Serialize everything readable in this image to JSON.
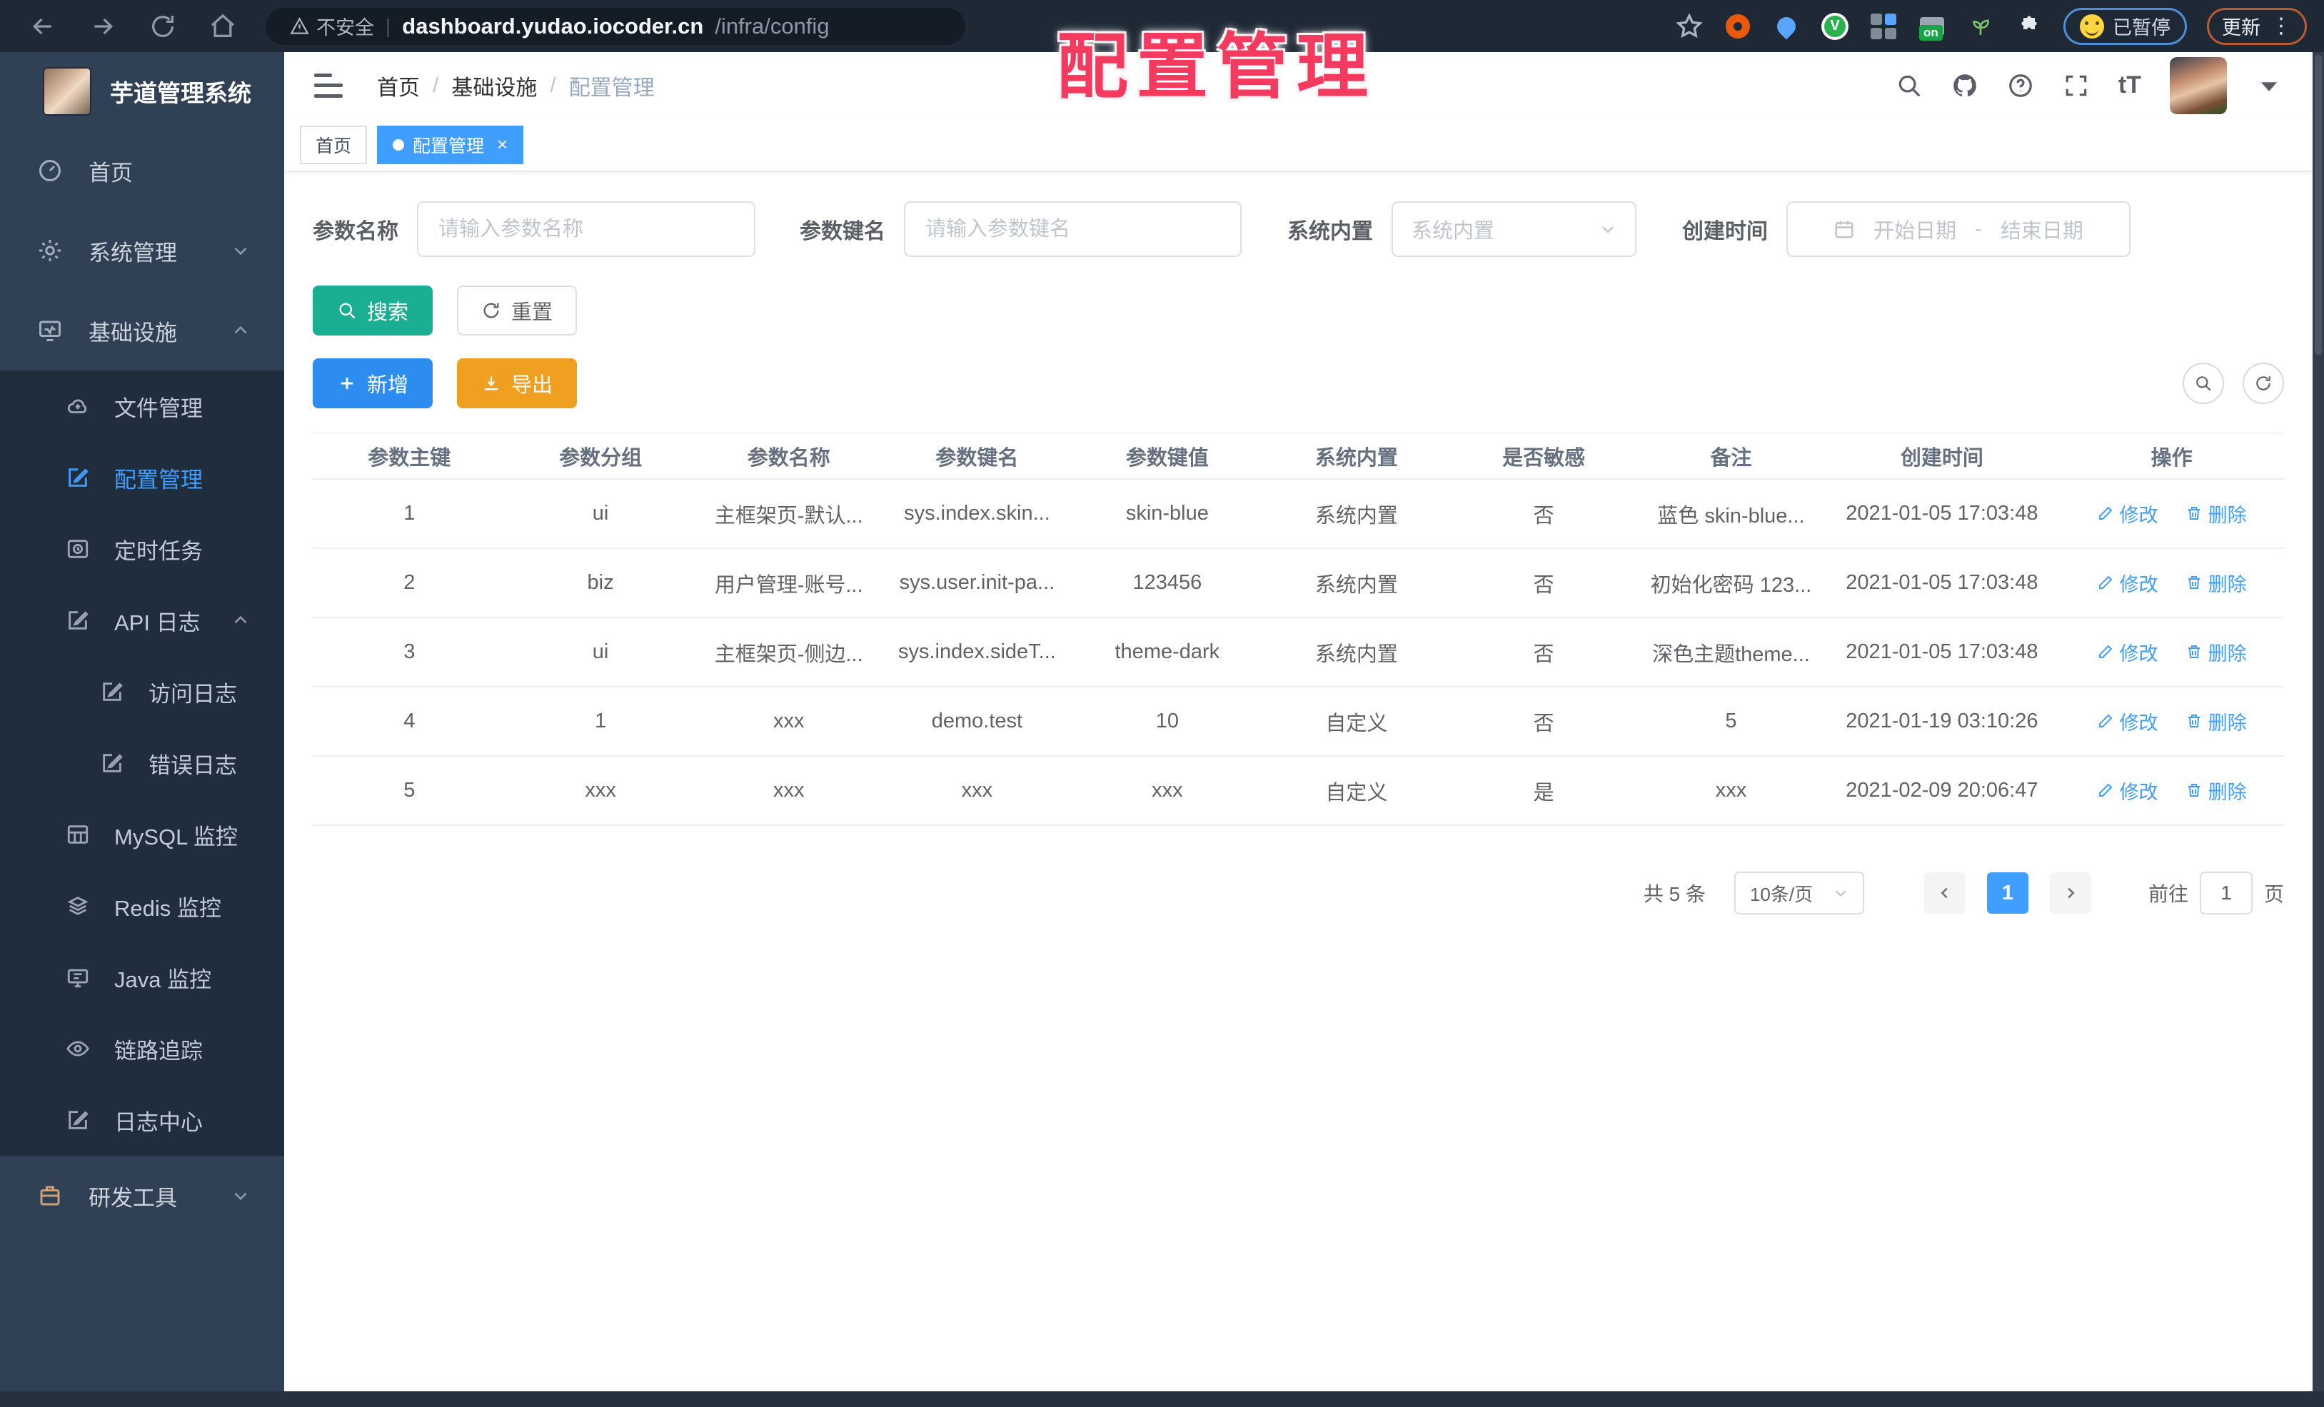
{
  "browser": {
    "security_label": "不安全",
    "url_host": "dashboard.yudao.iocoder.cn",
    "url_path": "/infra/config",
    "extension_badge": "on",
    "paused_pill": "已暂停",
    "update_button": "更新"
  },
  "annotation": {
    "text": "配置管理",
    "color": "#f43b5f"
  },
  "sidebar": {
    "title": "芋道管理系统",
    "items": [
      {
        "label": "首页",
        "level": 1
      },
      {
        "label": "系统管理",
        "level": 1,
        "expanded": false
      },
      {
        "label": "基础设施",
        "level": 1,
        "expanded": true
      },
      {
        "label": "文件管理",
        "level": 2
      },
      {
        "label": "配置管理",
        "level": 2,
        "active": true
      },
      {
        "label": "定时任务",
        "level": 2
      },
      {
        "label": "API 日志",
        "level": 2,
        "expanded": true
      },
      {
        "label": "访问日志",
        "level": 3
      },
      {
        "label": "错误日志",
        "level": 3
      },
      {
        "label": "MySQL 监控",
        "level": 2
      },
      {
        "label": "Redis 监控",
        "level": 2
      },
      {
        "label": "Java 监控",
        "level": 2
      },
      {
        "label": "链路追踪",
        "level": 2
      },
      {
        "label": "日志中心",
        "level": 2
      },
      {
        "label": "研发工具",
        "level": 1,
        "expanded": false
      }
    ]
  },
  "header": {
    "breadcrumb": [
      "首页",
      "基础设施",
      "配置管理"
    ],
    "separator": "/"
  },
  "tabs": [
    {
      "label": "首页",
      "active": false
    },
    {
      "label": "配置管理",
      "active": true
    }
  ],
  "filters": {
    "name_label": "参数名称",
    "name_placeholder": "请输入参数名称",
    "key_label": "参数键名",
    "key_placeholder": "请输入参数键名",
    "type_label": "系统内置",
    "type_placeholder": "系统内置",
    "date_label": "创建时间",
    "date_start_placeholder": "开始日期",
    "date_separator": "-",
    "date_end_placeholder": "结束日期"
  },
  "actions": {
    "search": "搜索",
    "reset": "重置",
    "create": "新增",
    "export": "导出"
  },
  "table": {
    "headers": [
      "参数主键",
      "参数分组",
      "参数名称",
      "参数键名",
      "参数键值",
      "系统内置",
      "是否敏感",
      "备注",
      "创建时间",
      "操作"
    ],
    "edit_label": "修改",
    "delete_label": "删除",
    "rows": [
      {
        "id": "1",
        "group": "ui",
        "name": "主框架页-默认...",
        "key": "sys.index.skin...",
        "value": "skin-blue",
        "type": "系统内置",
        "sensitive": "否",
        "remark": "蓝色 skin-blue...",
        "created": "2021-01-05 17:03:48"
      },
      {
        "id": "2",
        "group": "biz",
        "name": "用户管理-账号...",
        "key": "sys.user.init-pa...",
        "value": "123456",
        "type": "系统内置",
        "sensitive": "否",
        "remark": "初始化密码 123...",
        "created": "2021-01-05 17:03:48"
      },
      {
        "id": "3",
        "group": "ui",
        "name": "主框架页-侧边...",
        "key": "sys.index.sideT...",
        "value": "theme-dark",
        "type": "系统内置",
        "sensitive": "否",
        "remark": "深色主题theme...",
        "created": "2021-01-05 17:03:48"
      },
      {
        "id": "4",
        "group": "1",
        "name": "xxx",
        "key": "demo.test",
        "value": "10",
        "type": "自定义",
        "sensitive": "否",
        "remark": "5",
        "created": "2021-01-19 03:10:26"
      },
      {
        "id": "5",
        "group": "xxx",
        "name": "xxx",
        "key": "xxx",
        "value": "xxx",
        "type": "自定义",
        "sensitive": "是",
        "remark": "xxx",
        "created": "2021-02-09 20:06:47"
      }
    ]
  },
  "pagination": {
    "total": "共 5 条",
    "page_size": "10条/页",
    "current_page": "1",
    "goto_label": "前往",
    "goto_value": "1",
    "page_unit": "页"
  }
}
